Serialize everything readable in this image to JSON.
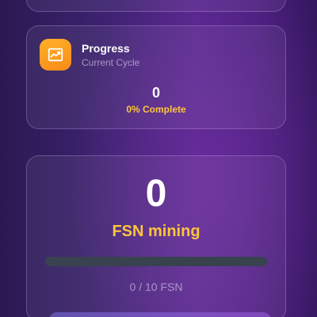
{
  "progress_card": {
    "icon": "trending-up-icon",
    "title": "Progress",
    "subtitle": "Current Cycle",
    "value": "0",
    "percent_text": "0% Complete"
  },
  "mining_card": {
    "value": "0",
    "label": "FSN mining",
    "bar_fraction": 0,
    "count_text": "0 / 10 FSN"
  },
  "colors": {
    "accent": "#ffc53a",
    "icon_tile": "#f98a17",
    "bar_track": "#39424f"
  }
}
